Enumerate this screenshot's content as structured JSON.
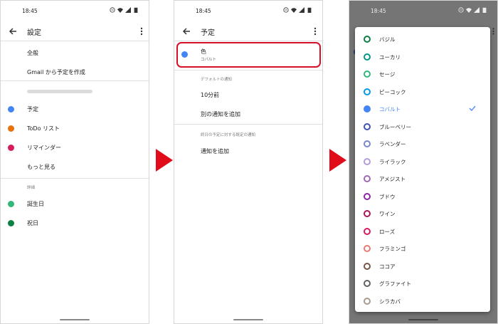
{
  "status": {
    "time": "18:45"
  },
  "panel1": {
    "title": "設定",
    "items_top": [
      "全般",
      "Gmail から予定を作成"
    ],
    "calendars": [
      {
        "label": "予定",
        "color": "#4285f4"
      },
      {
        "label": "ToDo リスト",
        "color": "#e8710a"
      },
      {
        "label": "リマインダー",
        "color": "#d81b60"
      },
      {
        "label": "もっと見る",
        "color": ""
      }
    ],
    "section_detail": "詳細",
    "details": [
      {
        "label": "誕生日",
        "color": "#33b679"
      },
      {
        "label": "祝日",
        "color": "#0b8043"
      }
    ]
  },
  "panel2": {
    "title": "予定",
    "color_label": "色",
    "color_value": "コバルト",
    "color_dot": "#4285f4",
    "section_default": "デフォルトの通知",
    "notif_time": "10分前",
    "add_notif": "別の通知を追加",
    "section_allday": "終日の予定に対する既定の通知",
    "add_notif2": "通知を追加"
  },
  "panel3": {
    "options": [
      {
        "label": "バジル",
        "color": "#0b8043"
      },
      {
        "label": "ユーカリ",
        "color": "#009688"
      },
      {
        "label": "セージ",
        "color": "#33b679"
      },
      {
        "label": "ピーコック",
        "color": "#039be5"
      },
      {
        "label": "コバルト",
        "color": "#4285f4",
        "selected": true
      },
      {
        "label": "ブルーベリー",
        "color": "#3f51b5"
      },
      {
        "label": "ラベンダー",
        "color": "#7986cb"
      },
      {
        "label": "ライラック",
        "color": "#b39ddb"
      },
      {
        "label": "アメジスト",
        "color": "#9e69af"
      },
      {
        "label": "ブドウ",
        "color": "#8e24aa"
      },
      {
        "label": "ワイン",
        "color": "#ad1457"
      },
      {
        "label": "ローズ",
        "color": "#d81b60"
      },
      {
        "label": "フラミンゴ",
        "color": "#e67c73"
      },
      {
        "label": "ココア",
        "color": "#795548"
      },
      {
        "label": "グラファイト",
        "color": "#616161"
      },
      {
        "label": "シラカバ",
        "color": "#a79b8e"
      }
    ]
  },
  "accent": "#e10c1a"
}
